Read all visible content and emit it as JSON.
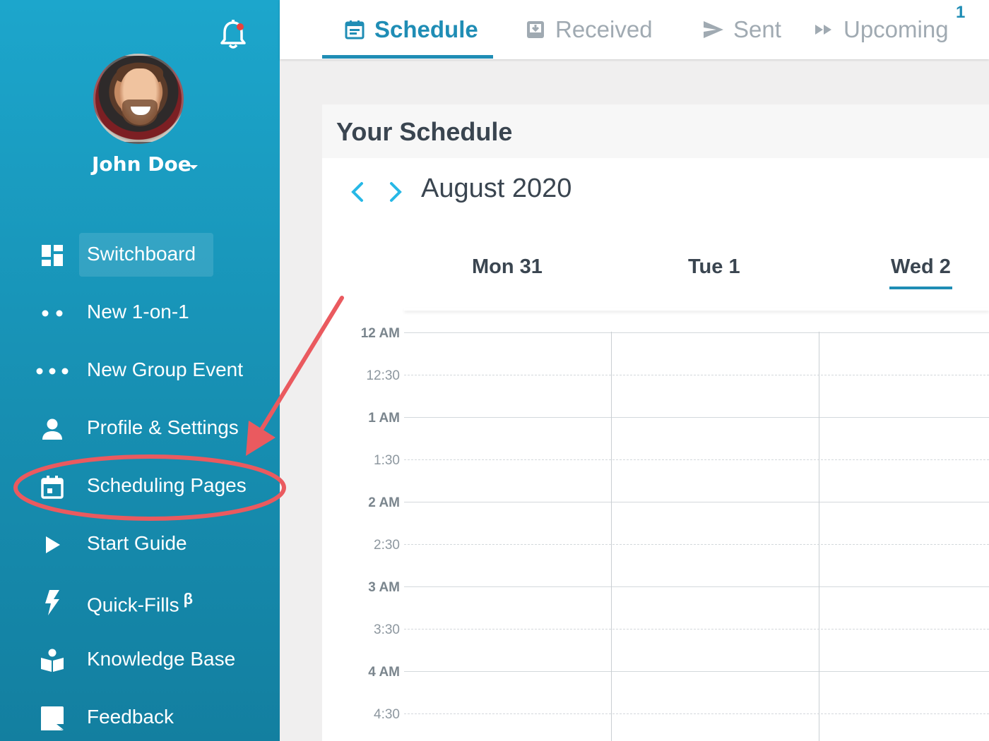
{
  "sidebar": {
    "user_name": "John Doe",
    "items": [
      {
        "label": "Switchboard",
        "icon": "dashboard-icon"
      },
      {
        "label": "New 1-on-1",
        "icon": "two-dots-icon"
      },
      {
        "label": "New Group Event",
        "icon": "three-dots-icon"
      },
      {
        "label": "Profile & Settings",
        "icon": "person-icon"
      },
      {
        "label": "Scheduling Pages",
        "icon": "calendar-icon"
      },
      {
        "label": "Start Guide",
        "icon": "play-icon"
      },
      {
        "label": "Quick-Fills",
        "icon": "lightning-icon",
        "superscript": "β"
      },
      {
        "label": "Knowledge Base",
        "icon": "book-icon"
      },
      {
        "label": "Feedback",
        "icon": "chat-icon"
      }
    ]
  },
  "tabs": [
    {
      "label": "Schedule",
      "icon": "calendar-icon",
      "active": true
    },
    {
      "label": "Received",
      "icon": "inbox-icon"
    },
    {
      "label": "Sent",
      "icon": "send-icon"
    },
    {
      "label": "Upcoming",
      "icon": "fast-forward-icon",
      "badge": "1"
    }
  ],
  "schedule": {
    "title": "Your Schedule",
    "month": "August 2020",
    "days": [
      {
        "label": "Mon 31"
      },
      {
        "label": "Tue 1"
      },
      {
        "label": "Wed 2",
        "today": true
      }
    ],
    "times": [
      "12 AM",
      "12:30",
      "1 AM",
      "1:30",
      "2 AM",
      "2:30",
      "3 AM",
      "3:30",
      "4 AM",
      "4:30"
    ]
  },
  "colors": {
    "sidebar_top": "#1ca6cc",
    "sidebar_bottom": "#137fa0",
    "accent": "#1f8db5",
    "arrow_accent": "#27b8e6",
    "annotation_red": "#ea5a5f"
  }
}
